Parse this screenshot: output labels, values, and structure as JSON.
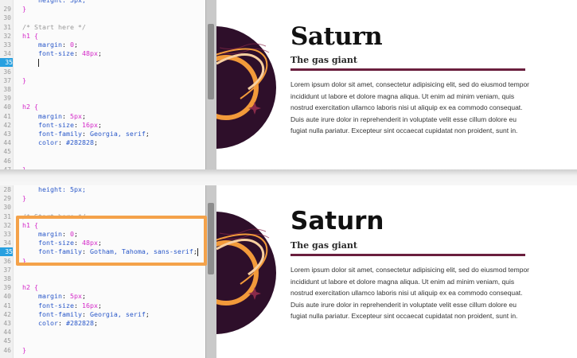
{
  "top": {
    "editor": {
      "lines": [
        {
          "num": "",
          "indent": 1,
          "tokens": [
            {
              "t": "height: 5px;",
              "c": "tok-prop"
            }
          ]
        },
        {
          "num": "29",
          "indent": 0,
          "tokens": [
            {
              "t": "}",
              "c": "tok-sel"
            }
          ]
        },
        {
          "num": "30",
          "indent": 0,
          "tokens": []
        },
        {
          "num": "31",
          "indent": 0,
          "tokens": [
            {
              "t": "/* Start here */",
              "c": "tok-comment"
            }
          ]
        },
        {
          "num": "32",
          "indent": 0,
          "tokens": [
            {
              "t": "h1 {",
              "c": "tok-sel"
            }
          ]
        },
        {
          "num": "33",
          "indent": 1,
          "tokens": [
            {
              "t": "margin",
              "c": "tok-prop"
            },
            {
              "t": ": ",
              "c": "tok-punc"
            },
            {
              "t": "0",
              "c": "tok-val"
            },
            {
              "t": ";",
              "c": "tok-punc"
            }
          ]
        },
        {
          "num": "34",
          "indent": 1,
          "tokens": [
            {
              "t": "font-size",
              "c": "tok-prop"
            },
            {
              "t": ": ",
              "c": "tok-punc"
            },
            {
              "t": "48px",
              "c": "tok-val"
            },
            {
              "t": ";",
              "c": "tok-punc"
            }
          ]
        },
        {
          "num": "35",
          "indent": 1,
          "active": true,
          "caret": true,
          "tokens": []
        },
        {
          "num": "36",
          "indent": 0,
          "tokens": []
        },
        {
          "num": "37",
          "indent": 0,
          "tokens": [
            {
              "t": "}",
              "c": "tok-sel"
            }
          ]
        },
        {
          "num": "38",
          "indent": 0,
          "tokens": []
        },
        {
          "num": "39",
          "indent": 0,
          "tokens": []
        },
        {
          "num": "40",
          "indent": 0,
          "tokens": [
            {
              "t": "h2 {",
              "c": "tok-sel"
            }
          ]
        },
        {
          "num": "41",
          "indent": 1,
          "tokens": [
            {
              "t": "margin",
              "c": "tok-prop"
            },
            {
              "t": ": ",
              "c": "tok-punc"
            },
            {
              "t": "5px",
              "c": "tok-val"
            },
            {
              "t": ";",
              "c": "tok-punc"
            }
          ]
        },
        {
          "num": "42",
          "indent": 1,
          "tokens": [
            {
              "t": "font-size",
              "c": "tok-prop"
            },
            {
              "t": ": ",
              "c": "tok-punc"
            },
            {
              "t": "16px",
              "c": "tok-val"
            },
            {
              "t": ";",
              "c": "tok-punc"
            }
          ]
        },
        {
          "num": "43",
          "indent": 1,
          "tokens": [
            {
              "t": "font-family",
              "c": "tok-prop"
            },
            {
              "t": ": ",
              "c": "tok-punc"
            },
            {
              "t": "Georgia, serif",
              "c": "tok-prop"
            },
            {
              "t": ";",
              "c": "tok-punc"
            }
          ]
        },
        {
          "num": "44",
          "indent": 1,
          "tokens": [
            {
              "t": "color",
              "c": "tok-prop"
            },
            {
              "t": ": ",
              "c": "tok-punc"
            },
            {
              "t": "#282828",
              "c": "tok-prop"
            },
            {
              "t": ";",
              "c": "tok-punc"
            }
          ]
        },
        {
          "num": "45",
          "indent": 0,
          "tokens": []
        },
        {
          "num": "46",
          "indent": 0,
          "tokens": []
        },
        {
          "num": "47",
          "indent": 0,
          "tokens": [
            {
              "t": "}",
              "c": "tok-sel"
            }
          ]
        }
      ]
    },
    "preview": {
      "title": "Saturn",
      "subtitle": "The gas giant",
      "paragraph": "Lorem ipsum dolor sit amet, consectetur adipisicing elit, sed do eiusmod tempor incididunt ut labore et dolore magna aliqua. Ut enim ad minim veniam, quis nostrud exercitation ullamco laboris nisi ut aliquip ex ea commodo consequat. Duis aute irure dolor in reprehenderit in voluptate velit esse cillum dolore eu fugiat nulla pariatur. Excepteur sint occaecat cupidatat non proident, sunt in."
    }
  },
  "bottom": {
    "editor": {
      "lines": [
        {
          "num": "28",
          "indent": 1,
          "tokens": [
            {
              "t": "height: 5px;",
              "c": "tok-prop"
            }
          ]
        },
        {
          "num": "29",
          "indent": 0,
          "tokens": [
            {
              "t": "}",
              "c": "tok-sel"
            }
          ]
        },
        {
          "num": "30",
          "indent": 0,
          "tokens": []
        },
        {
          "num": "31",
          "indent": 0,
          "tokens": [
            {
              "t": "/* Start here */",
              "c": "tok-comment"
            }
          ]
        },
        {
          "num": "32",
          "indent": 0,
          "tokens": [
            {
              "t": "h1 {",
              "c": "tok-sel"
            }
          ]
        },
        {
          "num": "33",
          "indent": 1,
          "tokens": [
            {
              "t": "margin",
              "c": "tok-prop"
            },
            {
              "t": ": ",
              "c": "tok-punc"
            },
            {
              "t": "0",
              "c": "tok-val"
            },
            {
              "t": ";",
              "c": "tok-punc"
            }
          ]
        },
        {
          "num": "34",
          "indent": 1,
          "tokens": [
            {
              "t": "font-size",
              "c": "tok-prop"
            },
            {
              "t": ": ",
              "c": "tok-punc"
            },
            {
              "t": "48px",
              "c": "tok-val"
            },
            {
              "t": ";",
              "c": "tok-punc"
            }
          ]
        },
        {
          "num": "35",
          "indent": 1,
          "active": true,
          "caret": true,
          "tokens": [
            {
              "t": "font-family",
              "c": "tok-prop"
            },
            {
              "t": ": ",
              "c": "tok-punc"
            },
            {
              "t": "Gotham, Tahoma, sans-serif",
              "c": "tok-prop"
            },
            {
              "t": ";",
              "c": "tok-punc"
            }
          ]
        },
        {
          "num": "36",
          "indent": 0,
          "tokens": [
            {
              "t": "}",
              "c": "tok-sel"
            }
          ]
        },
        {
          "num": "37",
          "indent": 0,
          "tokens": []
        },
        {
          "num": "38",
          "indent": 0,
          "tokens": []
        },
        {
          "num": "39",
          "indent": 0,
          "tokens": [
            {
              "t": "h2 {",
              "c": "tok-sel"
            }
          ]
        },
        {
          "num": "40",
          "indent": 1,
          "tokens": [
            {
              "t": "margin",
              "c": "tok-prop"
            },
            {
              "t": ": ",
              "c": "tok-punc"
            },
            {
              "t": "5px",
              "c": "tok-val"
            },
            {
              "t": ";",
              "c": "tok-punc"
            }
          ]
        },
        {
          "num": "41",
          "indent": 1,
          "tokens": [
            {
              "t": "font-size",
              "c": "tok-prop"
            },
            {
              "t": ": ",
              "c": "tok-punc"
            },
            {
              "t": "16px",
              "c": "tok-val"
            },
            {
              "t": ";",
              "c": "tok-punc"
            }
          ]
        },
        {
          "num": "42",
          "indent": 1,
          "tokens": [
            {
              "t": "font-family",
              "c": "tok-prop"
            },
            {
              "t": ": ",
              "c": "tok-punc"
            },
            {
              "t": "Georgia, serif",
              "c": "tok-prop"
            },
            {
              "t": ";",
              "c": "tok-punc"
            }
          ]
        },
        {
          "num": "43",
          "indent": 1,
          "tokens": [
            {
              "t": "color",
              "c": "tok-prop"
            },
            {
              "t": ": ",
              "c": "tok-punc"
            },
            {
              "t": "#282828",
              "c": "tok-prop"
            },
            {
              "t": ";",
              "c": "tok-punc"
            }
          ]
        },
        {
          "num": "44",
          "indent": 0,
          "tokens": []
        },
        {
          "num": "45",
          "indent": 0,
          "tokens": []
        },
        {
          "num": "46",
          "indent": 0,
          "tokens": [
            {
              "t": "}",
              "c": "tok-sel"
            }
          ]
        }
      ]
    },
    "preview": {
      "title": "Saturn",
      "subtitle": "The gas giant",
      "paragraph": "Lorem ipsum dolor sit amet, consectetur adipisicing elit, sed do eiusmod tempor incididunt ut labore et dolore magna aliqua. Ut enim ad minim veniam, quis nostrud exercitation ullamco laboris nisi ut aliquip ex ea commodo consequat. Duis aute irure dolor in reprehenderit in voluptate velit esse cillum dolore eu fugiat nulla pariatur. Excepteur sint occaecat cupidatat non proident, sunt in."
    }
  },
  "colors": {
    "planet": "#2e0f2a",
    "ring_orange": "#f29a3a",
    "ring_light": "#f7cfa0",
    "accent_rule": "#6a1f3e",
    "active_line": "#28a0e0",
    "highlight": "#f4a24a"
  }
}
